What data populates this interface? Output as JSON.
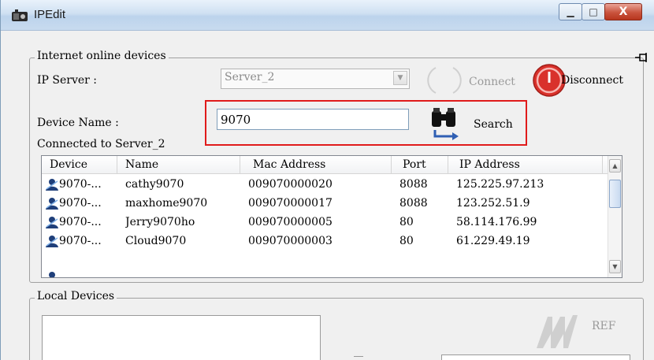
{
  "window": {
    "title": "IPEdit",
    "minimize_glyph": "▁",
    "maximize_glyph": "□",
    "close_glyph": "X"
  },
  "internet_group": {
    "legend": "Internet online devices",
    "ip_server_label": "IP Server :",
    "ip_server_value": "Server_2",
    "connect_label": "Connect",
    "disconnect_label": "Disconnect",
    "device_name_label": "Device Name :",
    "device_name_value": "9070",
    "search_label": "Search",
    "connected_label": "Connected to Server_2"
  },
  "device_table": {
    "columns": [
      "Device",
      "Name",
      "Mac Address",
      "Port",
      "IP Address"
    ],
    "rows": [
      {
        "device": "9070-...",
        "name": "cathy9070",
        "mac": "009070000020",
        "port": "8088",
        "ip": "125.225.97.213"
      },
      {
        "device": "9070-...",
        "name": "maxhome9070",
        "mac": "009070000017",
        "port": "8088",
        "ip": "123.252.51.9"
      },
      {
        "device": "9070-...",
        "name": "Jerry9070ho",
        "mac": "009070000005",
        "port": "80",
        "ip": "58.114.176.99"
      },
      {
        "device": "9070-...",
        "name": "Cloud9070",
        "mac": "009070000003",
        "port": "80",
        "ip": "61.229.49.19"
      }
    ]
  },
  "local_group": {
    "legend": "Local Devices",
    "ref_label": "REF"
  },
  "colors": {
    "highlight": "#e01b1b",
    "disconnect_red": "#d9312b"
  }
}
